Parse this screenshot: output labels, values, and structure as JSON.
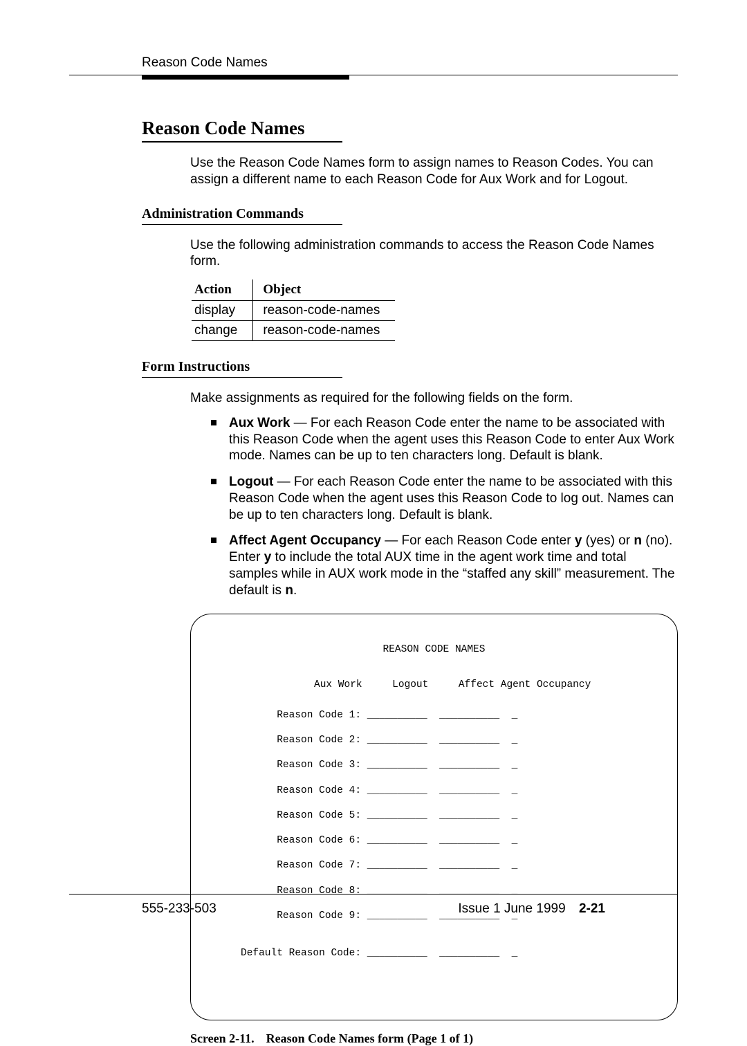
{
  "running_head": "Reason Code Names",
  "section_title": "Reason Code Names",
  "intro": "Use the Reason Code Names form to assign names to Reason Codes. You can assign a different name to each Reason Code for Aux Work and for Logout.",
  "admin_heading": "Administration Commands",
  "admin_intro": "Use the following administration commands to access the Reason Code Names form.",
  "cmd_table": {
    "headers": {
      "action": "Action",
      "object": "Object"
    },
    "rows": [
      {
        "action": "display",
        "object": "reason-code-names"
      },
      {
        "action": "change",
        "object": "reason-code-names"
      }
    ]
  },
  "form_heading": "Form Instructions",
  "form_intro": "Make assignments as required for the following fields on the form.",
  "bullets": {
    "aux_work": {
      "label": "Aux Work",
      "text": " — For each Reason Code enter the name to be associated with this Reason Code when the agent uses this Reason Code to enter Aux Work mode. Names can be up to ten characters long. Default is blank."
    },
    "logout": {
      "label": "Logout",
      "text": " — For each Reason Code enter the name to be associated with this Reason Code when the agent uses this Reason Code to log out. Names can be up to ten characters long. Default is blank."
    },
    "occupancy": {
      "label": "Affect Agent Occupancy",
      "text_a": " — For each Reason Code enter ",
      "y": "y",
      "text_b": " (yes) or ",
      "n": "n",
      "text_c": " (no). Enter ",
      "y2": "y",
      "text_d": " to include the total AUX time in the agent work time and total samples while in AUX work mode in the “staffed any skill” measurement. The default is ",
      "n2": "n",
      "text_e": "."
    }
  },
  "screen": {
    "title": "REASON CODE NAMES",
    "col_headers": "Aux Work     Logout     Affect Agent Occupancy",
    "rows": [
      "      Reason Code 1: __________  __________  _",
      "      Reason Code 2: __________  __________  _",
      "      Reason Code 3: __________  __________  _",
      "      Reason Code 4: __________  __________  _",
      "      Reason Code 5: __________  __________  _",
      "      Reason Code 6: __________  __________  _",
      "      Reason Code 7: __________  __________  _",
      "      Reason Code 8: __________  __________  _",
      "      Reason Code 9: __________  __________  _",
      "",
      "Default Reason Code: __________  __________  _"
    ]
  },
  "caption": {
    "label": "Screen 2-11.",
    "text": "Reason Code Names form (Page 1 of 1)"
  },
  "footer": {
    "left": "555-233-503",
    "issue": "Issue 1 June 1999",
    "page": "2-21"
  }
}
